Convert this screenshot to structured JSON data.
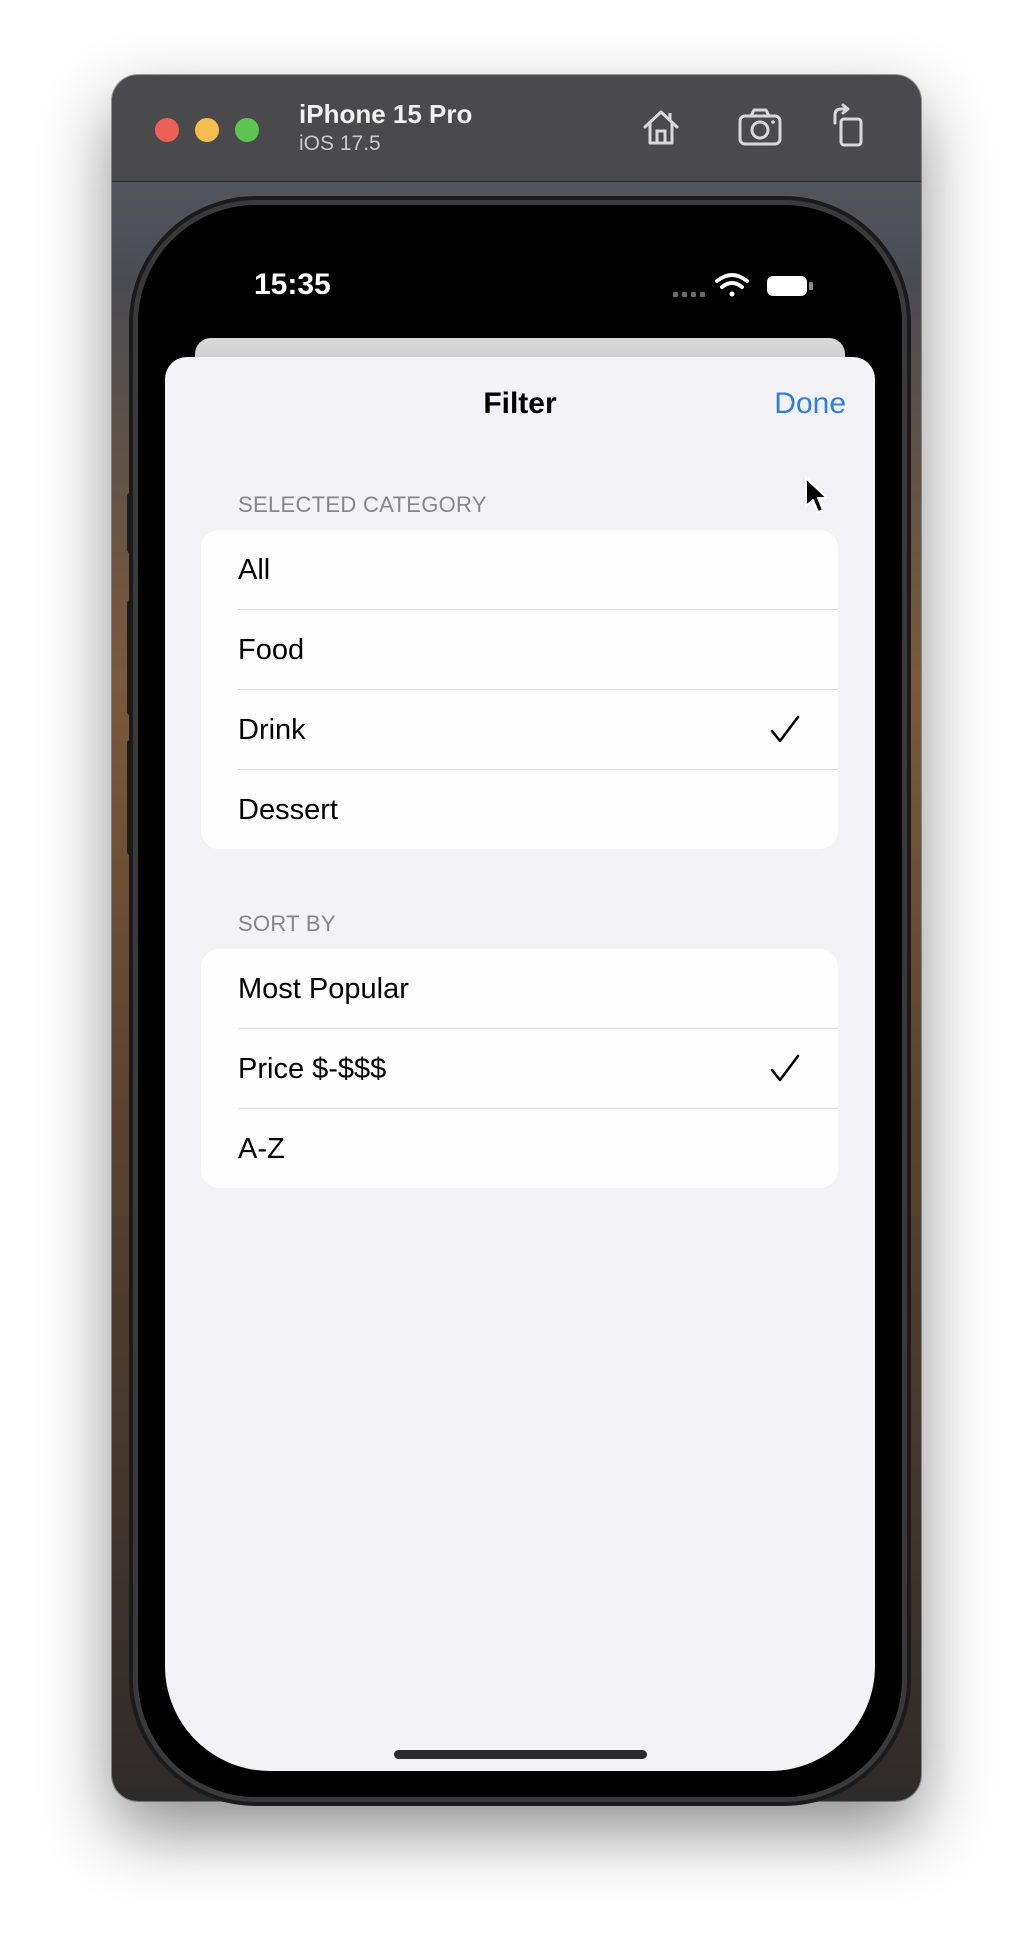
{
  "simulator": {
    "device_name": "iPhone 15 Pro",
    "os_version": "iOS 17.5",
    "toolbar_icons": [
      "home-icon",
      "screenshot-icon",
      "rotate-icon"
    ]
  },
  "status_bar": {
    "time": "15:35",
    "icons": [
      "signal-icon",
      "wifi-icon",
      "battery-icon"
    ]
  },
  "sheet": {
    "title": "Filter",
    "done_label": "Done",
    "accent_color": "#2f7fd6",
    "sections": [
      {
        "header": "SELECTED CATEGORY",
        "rows": [
          {
            "label": "All",
            "checked": false
          },
          {
            "label": "Food",
            "checked": false
          },
          {
            "label": "Drink",
            "checked": true
          },
          {
            "label": "Dessert",
            "checked": false
          }
        ]
      },
      {
        "header": "SORT BY",
        "rows": [
          {
            "label": "Most Popular",
            "checked": false
          },
          {
            "label": "Price $-$$$",
            "checked": true
          },
          {
            "label": "A-Z",
            "checked": false
          }
        ]
      }
    ]
  }
}
